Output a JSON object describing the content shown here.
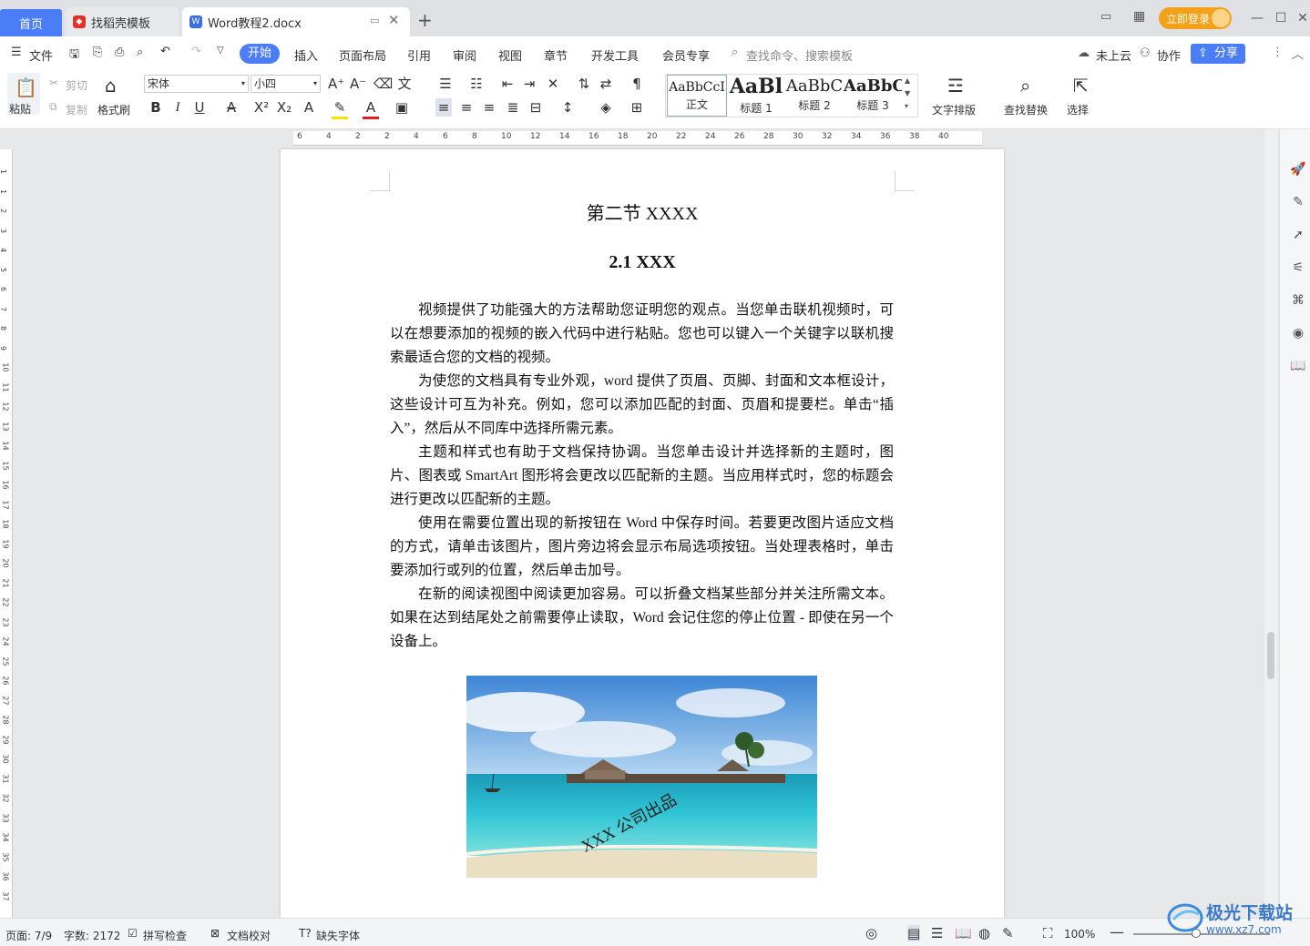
{
  "tabs": {
    "home": "首页",
    "template": "找稻壳模板",
    "doc": "Word教程2.docx",
    "login": "立即登录"
  },
  "menu": {
    "file": "文件",
    "items": [
      "开始",
      "插入",
      "页面布局",
      "引用",
      "审阅",
      "视图",
      "章节",
      "开发工具",
      "会员专享"
    ],
    "search_placeholder": "查找命令、搜索模板",
    "cloud": "未上云",
    "collab": "协作",
    "share": "分享"
  },
  "ribbon": {
    "paste": "粘贴",
    "cut": "剪切",
    "copy": "复制",
    "format_painter": "格式刷",
    "font": "宋体",
    "size": "小四",
    "styles": [
      {
        "preview": "AaBbCcI",
        "name": "正文"
      },
      {
        "preview": "AaBl",
        "name": "标题 1"
      },
      {
        "preview": "AaBbC",
        "name": "标题 2"
      },
      {
        "preview": "AaBbC",
        "name": "标题 3"
      }
    ],
    "text_layout": "文字排版",
    "find_replace": "查找替换",
    "select": "选择"
  },
  "ruler_marks": [
    "6",
    "4",
    "2",
    "2",
    "4",
    "6",
    "8",
    "10",
    "12",
    "14",
    "16",
    "18",
    "20",
    "22",
    "24",
    "26",
    "28",
    "30",
    "32",
    "34",
    "36",
    "38",
    "40"
  ],
  "vruler_marks": [
    "1",
    "1",
    "2",
    "3",
    "4",
    "5",
    "6",
    "7",
    "8",
    "9",
    "10",
    "11",
    "12",
    "13",
    "14",
    "15",
    "16",
    "17",
    "18",
    "19",
    "20",
    "21",
    "22",
    "23",
    "24",
    "25",
    "26",
    "27",
    "28",
    "29",
    "30",
    "31",
    "32",
    "33",
    "34",
    "35",
    "36",
    "37"
  ],
  "document": {
    "heading1": "第二节  XXXX",
    "heading2": "2.1 XXX",
    "paragraphs": [
      "视频提供了功能强大的方法帮助您证明您的观点。当您单击联机视频时，可以在想要添加的视频的嵌入代码中进行粘贴。您也可以键入一个关键字以联机搜索最适合您的文档的视频。",
      "为使您的文档具有专业外观，word 提供了页眉、页脚、封面和文本框设计，这些设计可互为补充。例如，您可以添加匹配的封面、页眉和提要栏。单击“插入”，然后从不同库中选择所需元素。",
      "主题和样式也有助于文档保持协调。当您单击设计并选择新的主题时，图片、图表或 SmartArt 图形将会更改以匹配新的主题。当应用样式时，您的标题会进行更改以匹配新的主题。",
      "使用在需要位置出现的新按钮在 Word 中保存时间。若要更改图片适应文档的方式，请单击该图片，图片旁边将会显示布局选项按钮。当处理表格时，单击要添加行或列的位置，然后单击加号。",
      "在新的阅读视图中阅读更加容易。可以折叠文档某些部分并关注所需文本。如果在达到结尾处之前需要停止读取，Word 会记住您的停止位置 - 即使在另一个设备上。"
    ],
    "image_watermark": "XXX 公司出品"
  },
  "status": {
    "page": "页面: 7/9",
    "words": "字数: 2172",
    "spell": "拼写检查",
    "proof": "文档校对",
    "missing_font": "缺失字体",
    "zoom": "100%"
  },
  "site_watermark": {
    "name": "极光下载站",
    "url": "www.xz7.com"
  },
  "colors": {
    "accent": "#4a7df7",
    "login": "#f4a019"
  }
}
